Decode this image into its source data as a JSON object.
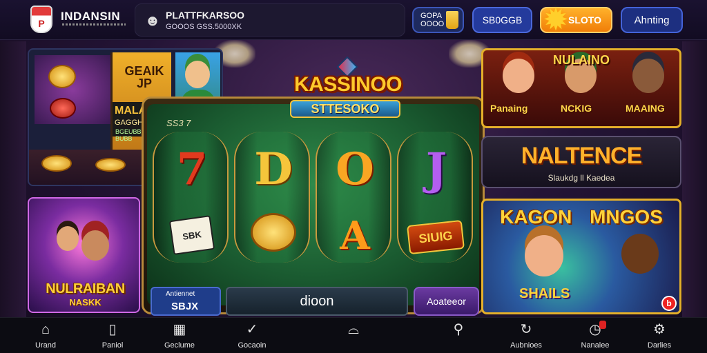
{
  "header": {
    "brand": "INDANSIN",
    "promo_title": "PLATTFKARSOO",
    "promo_sub": "GOOOS GSS.5000XK",
    "coin_label": "GOPA OOOO",
    "btn_b": "SB0GGB",
    "btn_slot": "SLOTO",
    "btn_alert": "Ahnting"
  },
  "left": {
    "card_tl_title": "GEAIK JP",
    "card_tl_band": "MALAIKO",
    "card_tl_band2": "GAGGHGUK",
    "card_tl_band3": "BGEUBBEUG BUBB",
    "card_bl_title": "NULRAIBAN",
    "card_bl_sub": "NASKK"
  },
  "slot": {
    "title": "KASSINOO",
    "subtitle": "STTESOKO",
    "reel_label": "SS3 7",
    "reels": [
      {
        "top": "7",
        "bottom": "SBK"
      },
      {
        "top": "D",
        "bottom": ""
      },
      {
        "top": "O",
        "bottom": "A"
      },
      {
        "top": "J",
        "bottom": "SIUIG"
      }
    ],
    "bar1_line1": "Antiennet",
    "bar1_line2": "SBJX",
    "bar2": "dioon",
    "bar3": "Aoateeor"
  },
  "right": {
    "tr_title": "NULAINO",
    "tr_label_left": "Panaing",
    "tr_label_mid": "NCKIG",
    "tr_label_right": "MAAING",
    "mr_title": "NALTENCE",
    "mr_sub": "Slaukdg ll Kaedea",
    "br_title": "KAGON MNGOS",
    "br_label": "SHAILS",
    "br_badge": "b"
  },
  "nav": [
    {
      "icon": "home-icon",
      "label": "Urand"
    },
    {
      "icon": "book-icon",
      "label": "Paniol"
    },
    {
      "icon": "grid-icon",
      "label": "Geclume"
    },
    {
      "icon": "check-icon",
      "label": "Gocaoin"
    },
    {
      "icon": "hat-icon",
      "label": ""
    },
    {
      "icon": "search-icon",
      "label": ""
    },
    {
      "icon": "refresh-icon",
      "label": "Aubnioes"
    },
    {
      "icon": "clock-icon",
      "label": "Nanalee"
    },
    {
      "icon": "settings-icon",
      "label": "Darlies"
    }
  ],
  "colors": {
    "accent": "#ffca2b",
    "slot_green": "#1a5a30",
    "nav_bg": "#0c0c12"
  }
}
